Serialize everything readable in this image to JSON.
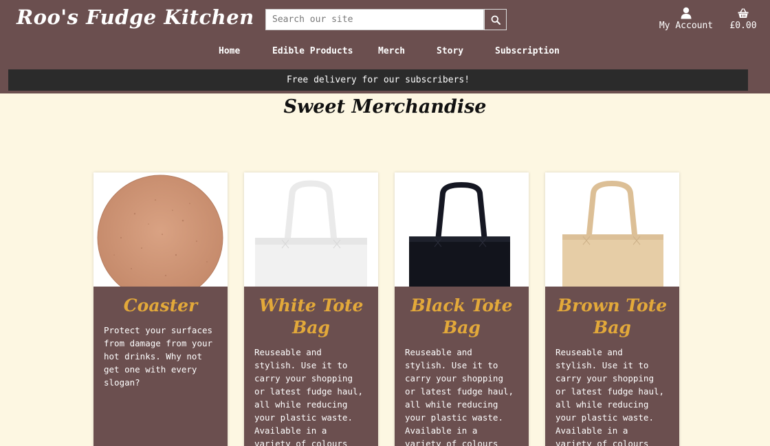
{
  "header": {
    "logo": "Roo's Fudge Kitchen",
    "search_placeholder": "Search our site",
    "account_label": "My Account",
    "basket_total": "£0.00"
  },
  "nav": [
    "Home",
    "Edible Products",
    "Merch",
    "Story",
    "Subscription"
  ],
  "banner": "Free delivery for our subscribers!",
  "page_title": "Sweet Merchandise",
  "products": [
    {
      "title": "Coaster",
      "text": "Protect your surfaces from damage from your hot drinks. Why not get one with every slogan?"
    },
    {
      "title": "White Tote Bag",
      "text": "Reuseable and stylish. Use it to carry your shopping or latest fudge haul, all while reducing your plastic waste. Available in a variety of colours and slogans."
    },
    {
      "title": "Black Tote Bag",
      "text": "Reuseable and stylish. Use it to carry your shopping or latest fudge haul, all while reducing your plastic waste. Available in a variety of colours and slogans."
    },
    {
      "title": "Brown Tote Bag",
      "text": "Reuseable and stylish. Use it to carry your shopping or latest fudge haul, all while reducing your plastic waste. Available in a variety of colours and slogans."
    }
  ],
  "colors": {
    "header_bg": "#6b4f4f",
    "page_bg": "#fdf7e2",
    "accent": "#e3a93a",
    "banner_bg": "#2b2b2b"
  },
  "icons": {
    "search": "search-icon",
    "account": "user-icon",
    "basket": "basket-icon"
  }
}
